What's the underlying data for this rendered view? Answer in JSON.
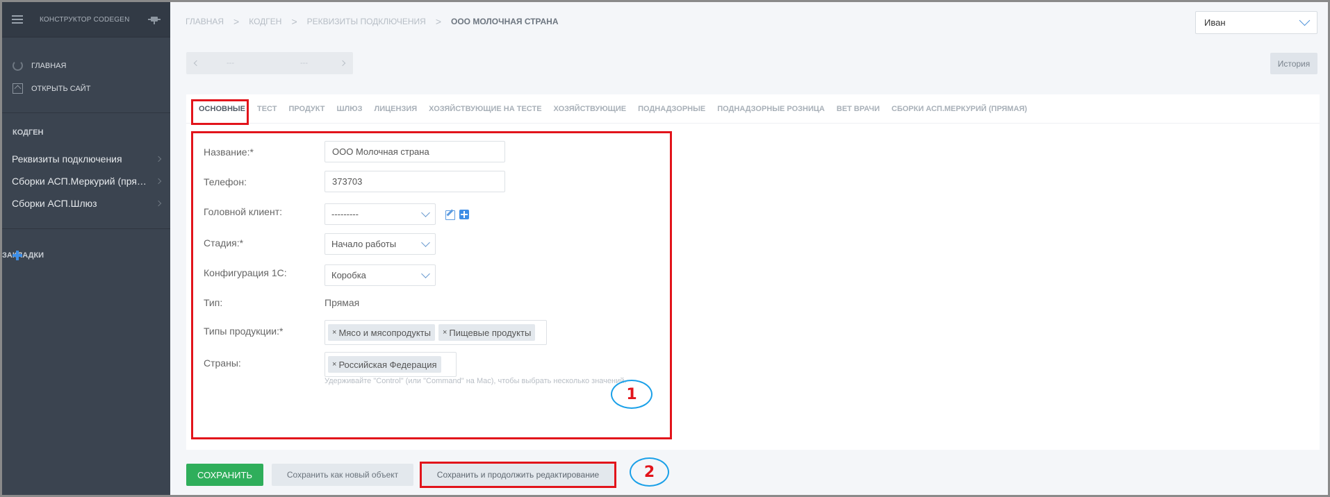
{
  "sidebar": {
    "brand": "КОНСТРУКТОР CODEGEN",
    "top_items": [
      {
        "label": "ГЛАВНАЯ"
      },
      {
        "label": "ОТКРЫТЬ САЙТ"
      }
    ],
    "section_title": "КОДГЕН",
    "links": [
      {
        "label": "Реквизиты подключения"
      },
      {
        "label": "Сборки АСП.Меркурий (прямая)"
      },
      {
        "label": "Сборки АСП.Шлюз"
      }
    ],
    "bookmarks_label": "ЗАКЛАДКИ"
  },
  "breadcrumb": {
    "items": [
      "ГЛАВНАЯ",
      "КОДГЕН",
      "РЕКВИЗИТЫ ПОДКЛЮЧЕНИЯ"
    ],
    "separator": ">",
    "current": "ООО МОЛОЧНАЯ СТРАНА"
  },
  "user": {
    "name": "Иван"
  },
  "pager": {
    "left_dots": "---",
    "right_dots": "---"
  },
  "history_button": "История",
  "tabs": [
    {
      "label": "ОСНОВНЫЕ",
      "active": true
    },
    {
      "label": "ТЕСТ"
    },
    {
      "label": "ПРОДУКТ"
    },
    {
      "label": "ШЛЮЗ"
    },
    {
      "label": "ЛИЦЕНЗИЯ"
    },
    {
      "label": "ХОЗЯЙСТВУЮЩИЕ НА ТЕСТЕ"
    },
    {
      "label": "ХОЗЯЙСТВУЮЩИЕ"
    },
    {
      "label": "ПОДНАДЗОРНЫЕ"
    },
    {
      "label": "ПОДНАДЗОРНЫЕ РОЗНИЦА"
    },
    {
      "label": "ВЕТ ВРАЧИ"
    },
    {
      "label": "СБОРКИ АСП.МЕРКУРИЙ (ПРЯМАЯ)"
    }
  ],
  "form": {
    "name": {
      "label": "Название:*",
      "value": "ООО Молочная страна"
    },
    "phone": {
      "label": "Телефон:",
      "value": "373703"
    },
    "head_client": {
      "label": "Головной клиент:",
      "value": "---------"
    },
    "stage": {
      "label": "Стадия:*",
      "value": "Начало работы"
    },
    "config": {
      "label": "Конфигурация 1С:",
      "value": "Коробка"
    },
    "type": {
      "label": "Тип:",
      "value": "Прямая"
    },
    "product_types": {
      "label": "Типы продукции:*",
      "chips": [
        "Мясо и мясопродукты",
        "Пищевые продукты"
      ]
    },
    "countries": {
      "label": "Страны:",
      "chips": [
        "Российская Федерация"
      ]
    },
    "help_text": "Удерживайте \"Control\" (или \"Command\" на Mac), чтобы выбрать несколько значений."
  },
  "chip_remove": "×",
  "buttons": {
    "save": "СОХРАНИТЬ",
    "save_as_new": "Сохранить как новый объект",
    "save_continue": "Сохранить и продолжить редактирование"
  },
  "annotations": {
    "one": "1",
    "two": "2"
  },
  "colors": {
    "annotation_box": "#e2141b",
    "annotation_circle": "#1aa0e8",
    "save_button": "#2fae5b",
    "sidebar_bg": "#3b4450",
    "accent": "#3e8ee6"
  }
}
